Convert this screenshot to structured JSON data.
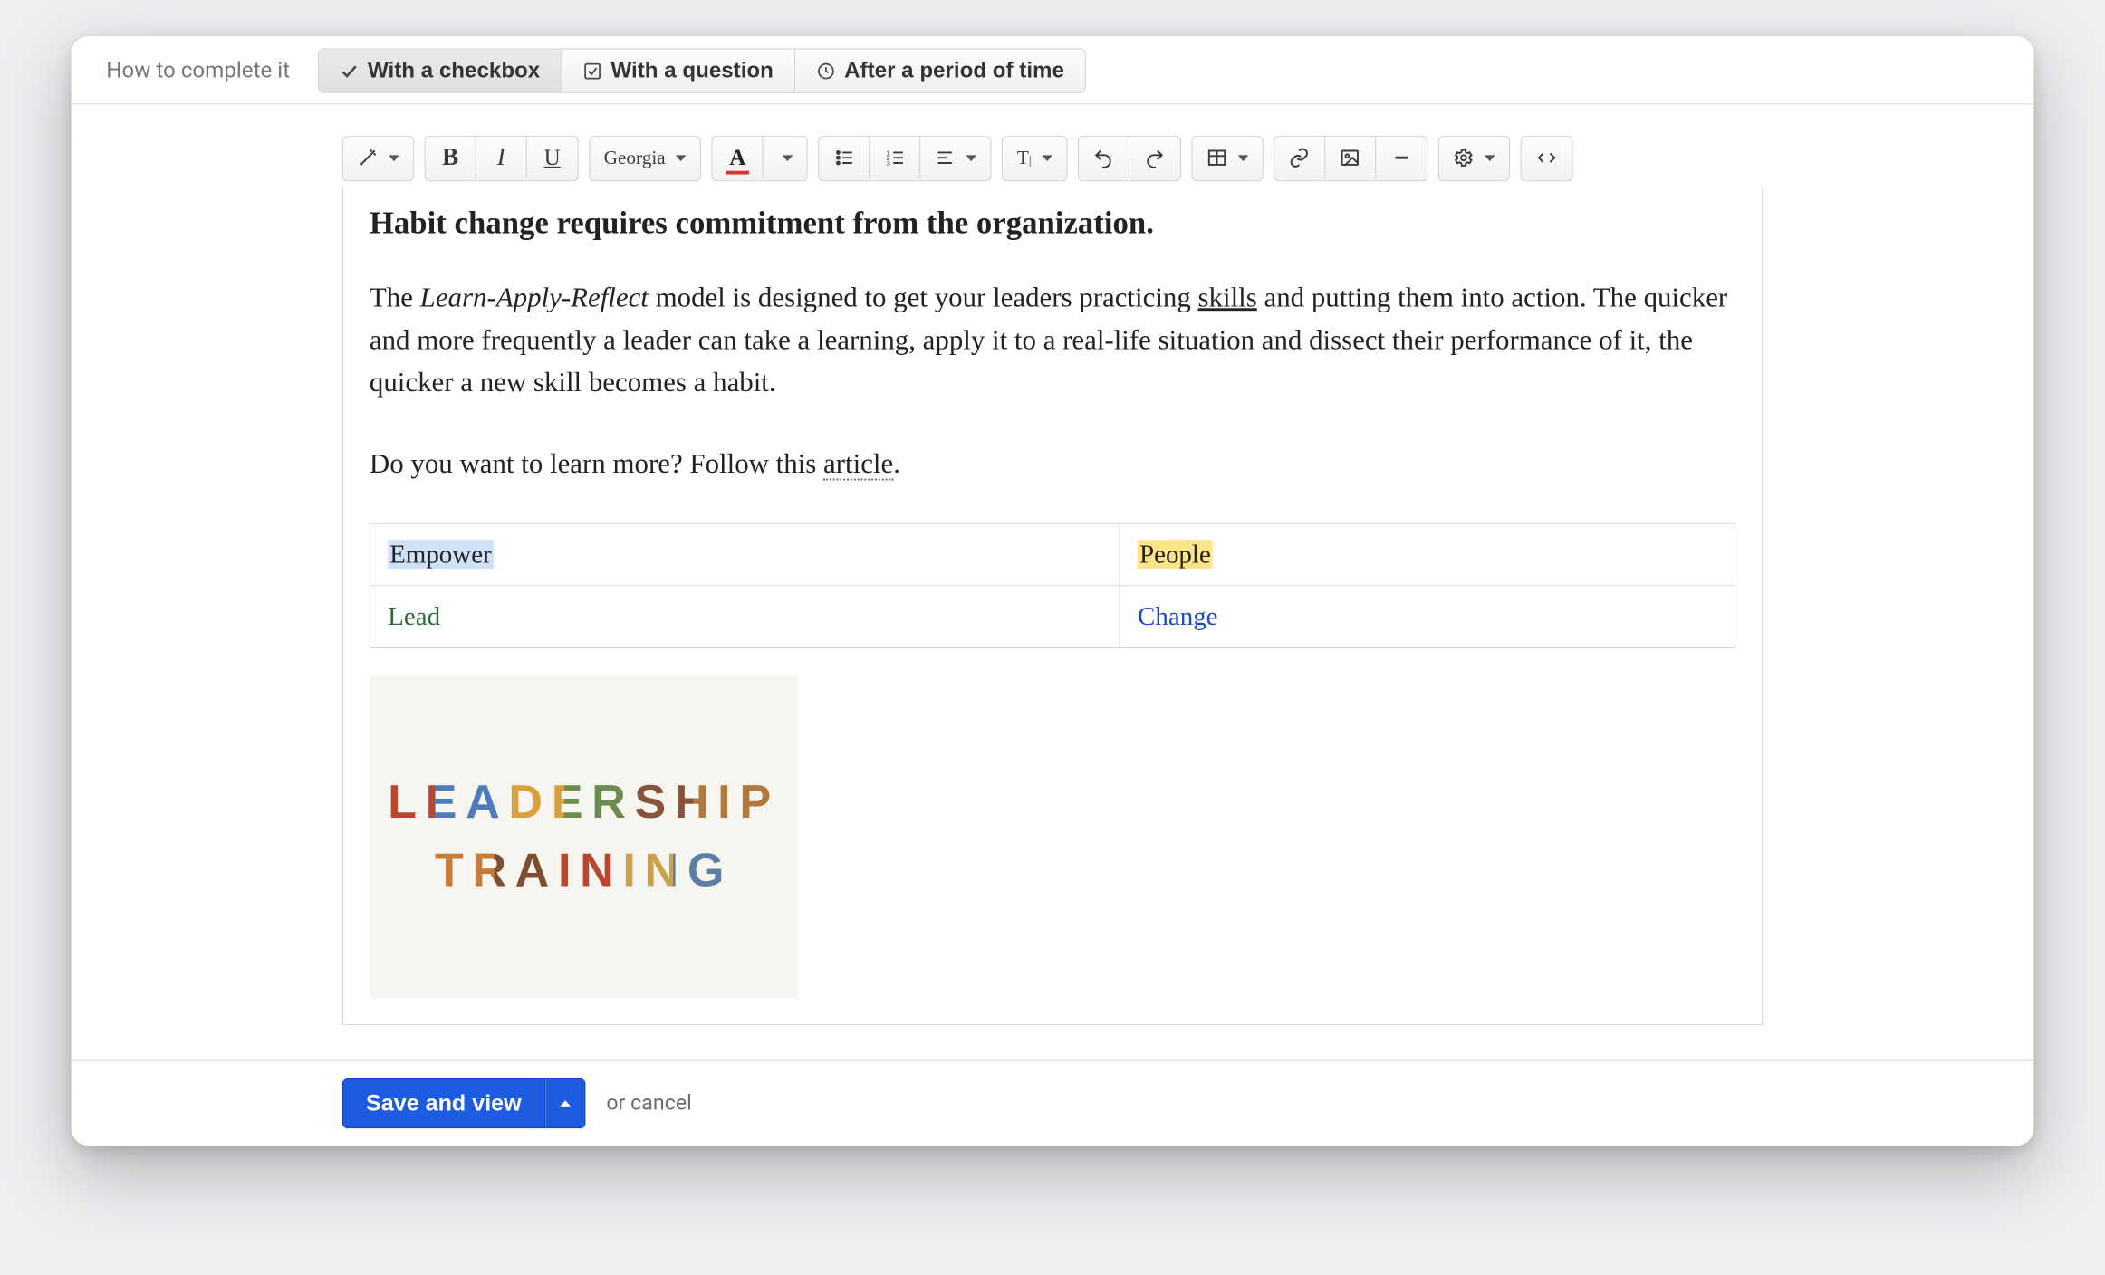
{
  "completion": {
    "label": "How to complete it",
    "options": [
      {
        "icon": "check-icon",
        "label": "With a checkbox",
        "active": true
      },
      {
        "icon": "checkbox-icon",
        "label": "With a question",
        "active": false
      },
      {
        "icon": "clock-icon",
        "label": "After a period of time",
        "active": false
      }
    ]
  },
  "toolbar": {
    "font_family": "Georgia",
    "font_sample_letter": "A"
  },
  "content": {
    "heading": "Habit change requires commitment from the organization.",
    "p1_pre": "The ",
    "p1_model": "Learn-Apply-Reflect",
    "p1_mid": " model is designed to get your leaders practicing ",
    "p1_skills": "skills",
    "p1_post": " and putting them into action. The quicker and more frequently a leader can take a learning, apply it to a real-life situation and dissect their performance of it, the quicker a new skill becomes a habit.",
    "p2_pre": "Do you want to learn more? Follow this ",
    "p2_link": "article",
    "p2_post": ".",
    "table": {
      "r1c1": "Empower",
      "r1c2": "People",
      "r2c1": "Lead",
      "r2c2": "Change"
    },
    "image": {
      "line1": "LEADERSHIP",
      "line2": "TRAINING"
    }
  },
  "footer": {
    "save_label": "Save and view",
    "or": "or ",
    "cancel": "cancel"
  }
}
